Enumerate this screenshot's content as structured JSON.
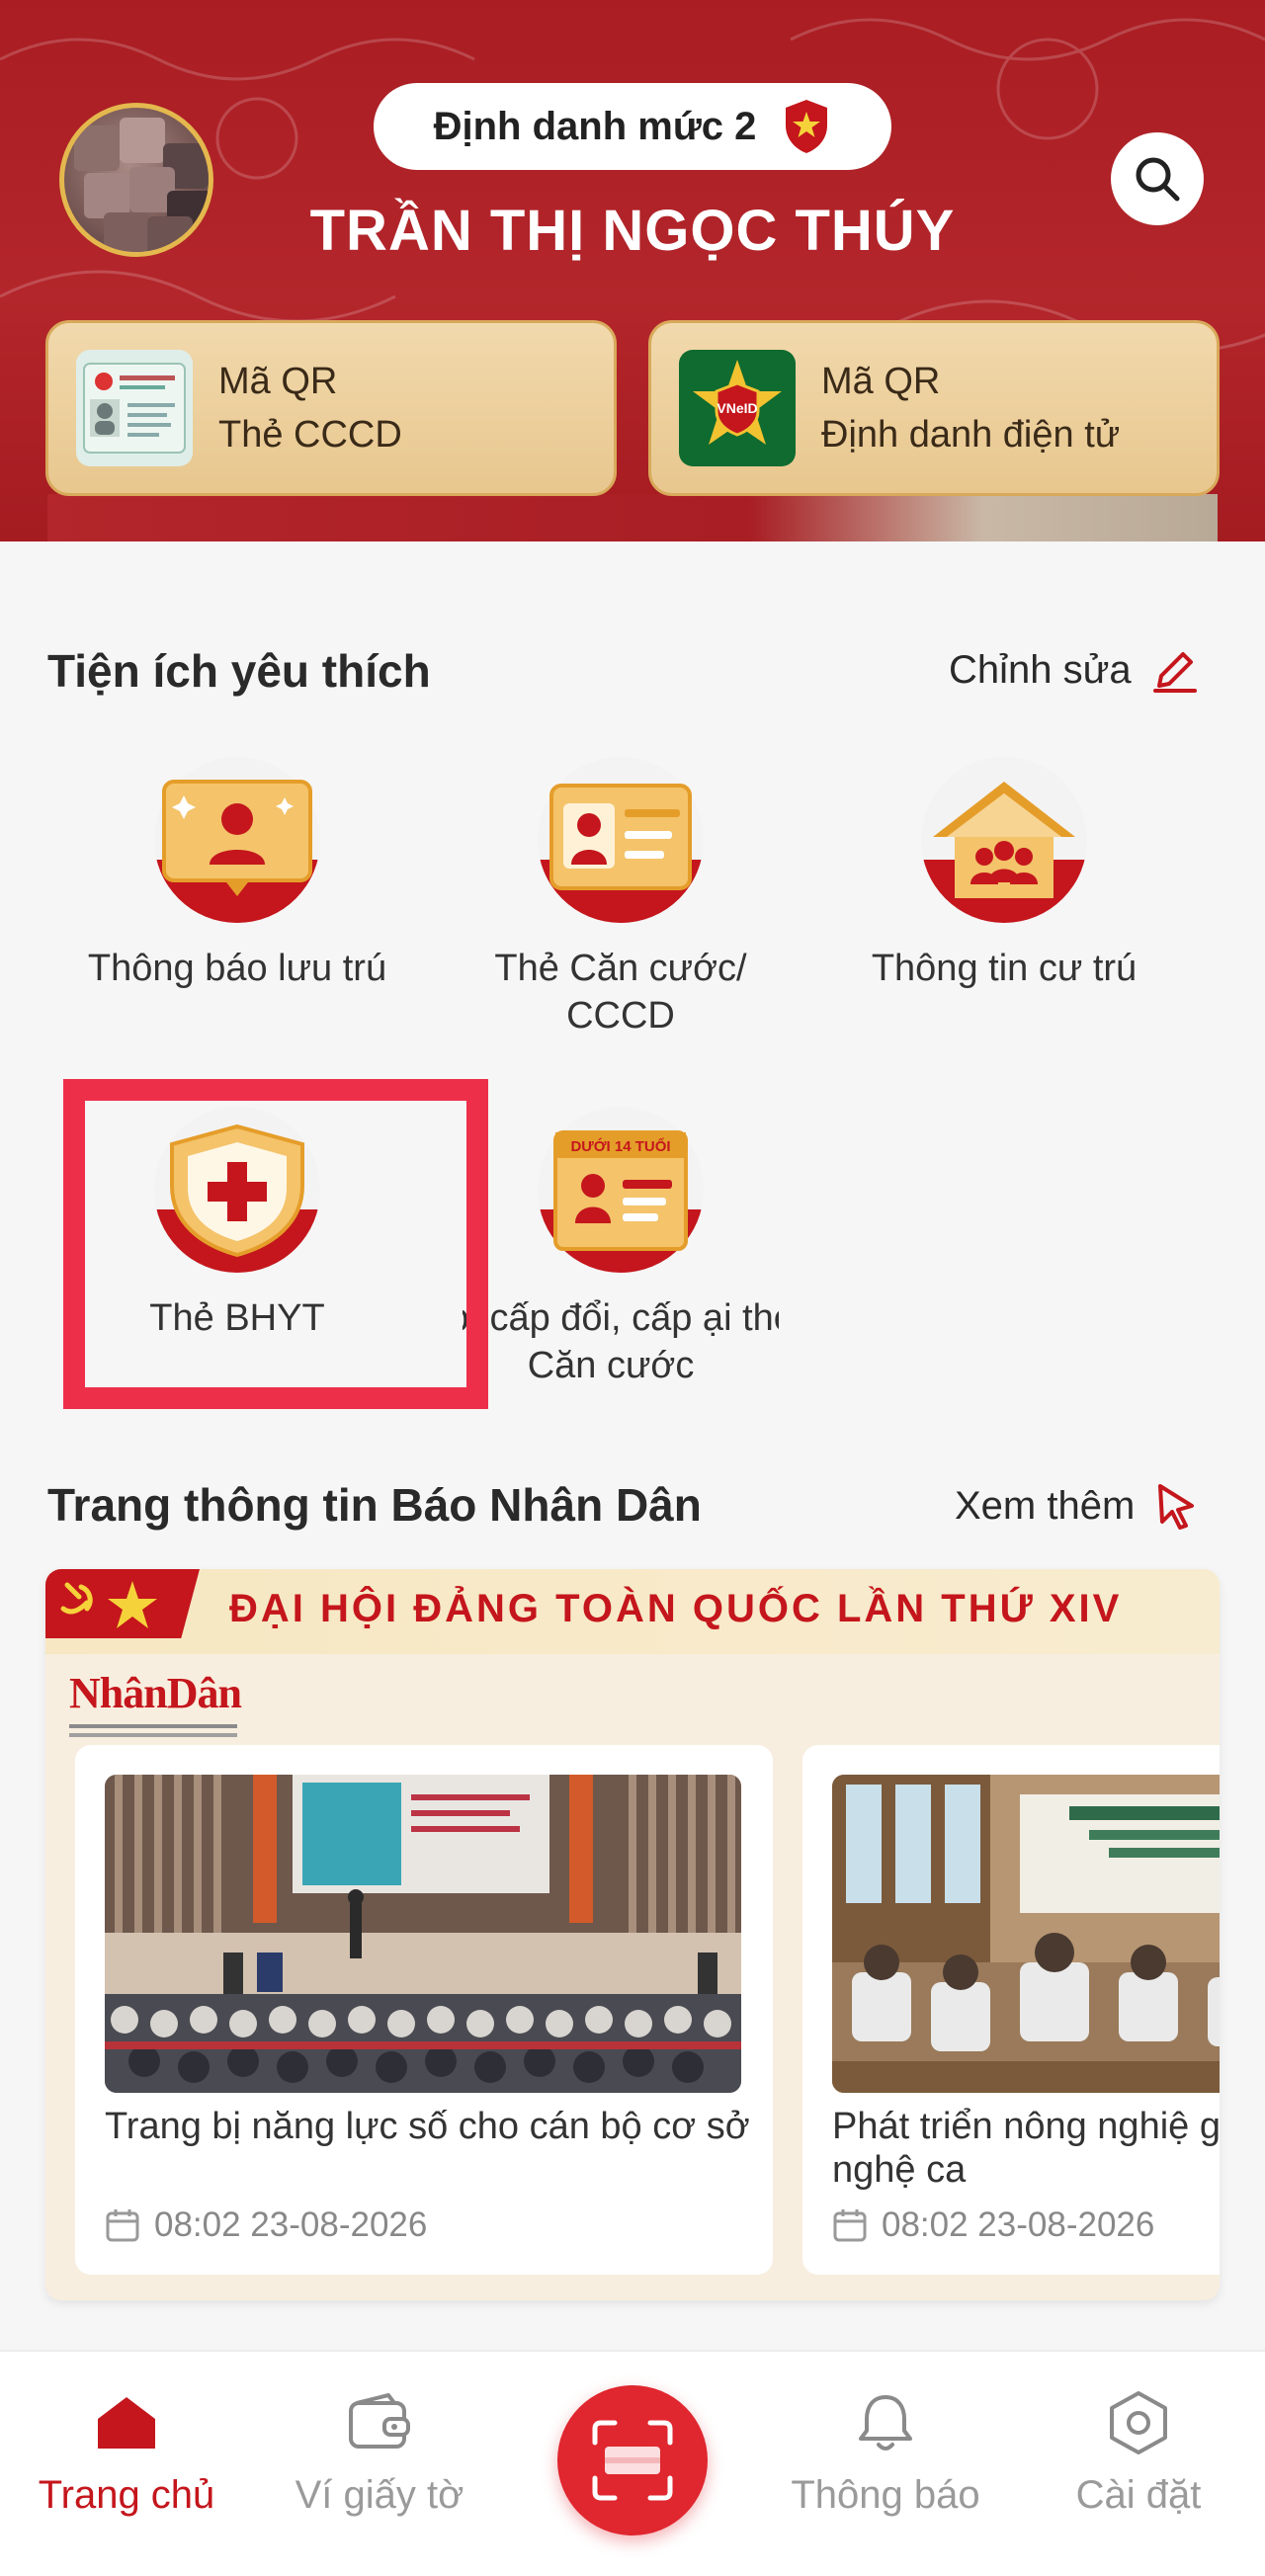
{
  "header": {
    "level_label": "Định danh mức 2",
    "user_name": "TRẦN THỊ NGỌC THÚY",
    "qr_cards": [
      {
        "line1": "Mã QR",
        "line2": "Thẻ CCCD"
      },
      {
        "line1": "Mã QR",
        "line2": "Định danh điện tử"
      }
    ],
    "badge_text": "VNeID"
  },
  "favorites": {
    "title": "Tiện ích yêu thích",
    "edit_label": "Chỉnh sửa",
    "items": [
      {
        "label": "Thông báo lưu trú"
      },
      {
        "label": "Thẻ Căn cước/ CCCD"
      },
      {
        "label": "Thông tin cư trú"
      },
      {
        "label": "Thẻ BHYT"
      },
      {
        "label": "ấp, cấp đổi, cấp ại thẻ Căn cước",
        "badge": "DƯỚI 14 TUỔI"
      }
    ]
  },
  "news": {
    "title": "Trang thông tin Báo Nhân Dân",
    "more_label": "Xem thêm",
    "banner": "ĐẠI HỘI ĐẢNG TOÀN QUỐC LẦN THỨ XIV",
    "logo": "NhânDân",
    "articles": [
      {
        "title": "Trang bị năng lực số cho cán bộ cơ sở",
        "time": "08:02 23-08-2026"
      },
      {
        "title": "Phát triển nông nghiệ gắn với công nghệ ca",
        "time": "08:02 23-08-2026"
      }
    ]
  },
  "nav": {
    "items": [
      {
        "label": "Trang chủ"
      },
      {
        "label": "Ví giấy tờ"
      },
      {
        "label": "Thông báo"
      },
      {
        "label": "Cài đặt"
      }
    ]
  },
  "colors": {
    "brand_red": "#c4161c",
    "header_red": "#a91d23",
    "gold": "#e4b84e",
    "highlight": "#ee2f4a"
  }
}
